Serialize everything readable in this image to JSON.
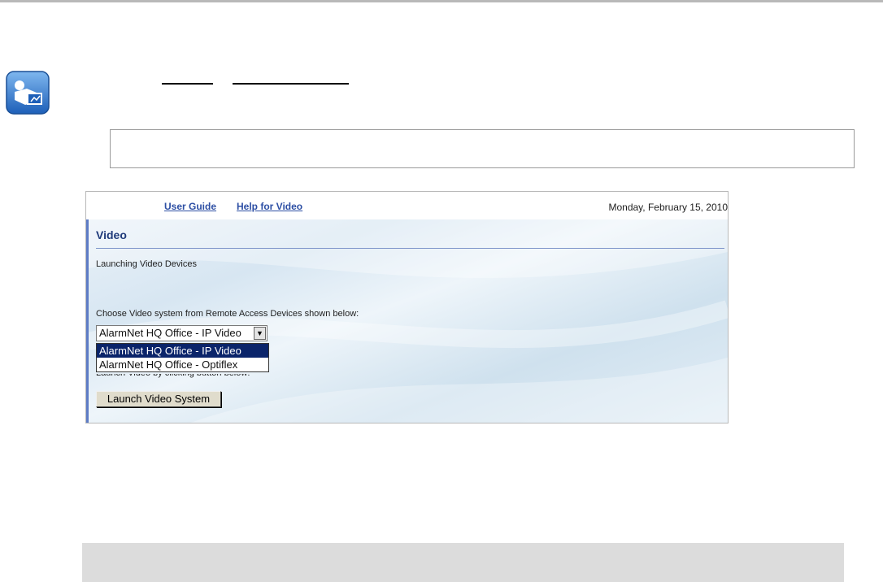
{
  "screenshot": {
    "links": {
      "user_guide": "User Guide",
      "help_for_video": "Help for Video"
    },
    "date": "Monday, February 15, 2010",
    "title": "Video",
    "subtitle": "Launching Video Devices",
    "choose_label": "Choose Video system from Remote Access Devices shown below:",
    "select": {
      "selected": "AlarmNet HQ Office - IP Video",
      "options": [
        "AlarmNet HQ Office - IP Video",
        "AlarmNet HQ Office - Optiflex"
      ]
    },
    "launch_instruction": "Launch Video by clicking button below:",
    "launch_button": "Launch Video System"
  },
  "icons": {
    "app": "video-camera-icon",
    "dropdown": "chevron-down-icon"
  },
  "colors": {
    "link": "#2d4fa4",
    "title": "#1f3a7a",
    "selection": "#0a246a",
    "icon_blue": "#2f7ad0"
  }
}
